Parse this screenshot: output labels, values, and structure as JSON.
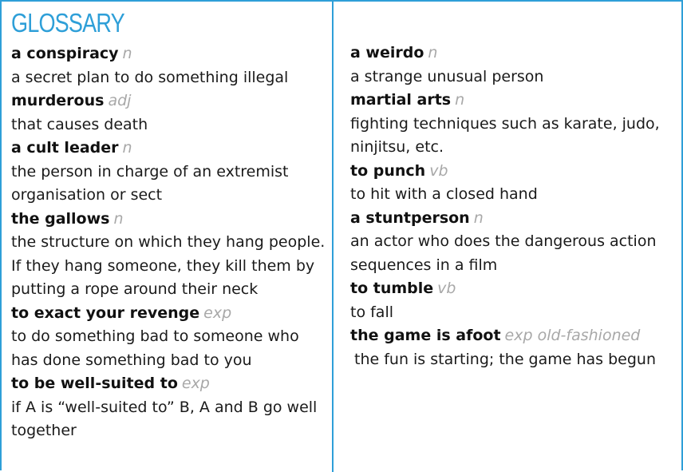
{
  "heading": "GLOSSARY",
  "left_entries": [
    {
      "term": "a conspiracy",
      "pos": "n",
      "definition": "a secret plan to do something illegal"
    },
    {
      "term": "murderous",
      "pos": "adj",
      "definition": "that causes death"
    },
    {
      "term": "a cult leader",
      "pos": "n",
      "definition": "the person in charge of an extremist organisation or sect"
    },
    {
      "term": "the gallows",
      "pos": "n",
      "definition": "the structure on which they hang people. If they hang someone, they kill them by putting a rope around their neck"
    },
    {
      "term": "to exact your revenge",
      "pos": "exp",
      "definition": "to do something bad to someone who has done something bad to you"
    },
    {
      "term": "to be well-suited to",
      "pos": "exp",
      "definition": "if A is “well-suited to” B, A and B go well together"
    }
  ],
  "right_entries": [
    {
      "term": "a weirdo",
      "pos": "n",
      "definition": "a strange unusual person"
    },
    {
      "term": "martial arts",
      "pos": "n",
      "definition": "fighting techniques such as karate, judo, ninjitsu, etc."
    },
    {
      "term": "to punch",
      "pos": "vb",
      "definition": "to hit with a closed hand"
    },
    {
      "term": "a stuntperson",
      "pos": "n",
      "definition": "an actor who does the dangerous action sequences in a film"
    },
    {
      "term": "to tumble",
      "pos": "vb",
      "definition": "to fall"
    },
    {
      "term": "the game is afoot",
      "pos": "exp old-fashioned",
      "definition": "the fun is starting; the game has begun"
    }
  ]
}
